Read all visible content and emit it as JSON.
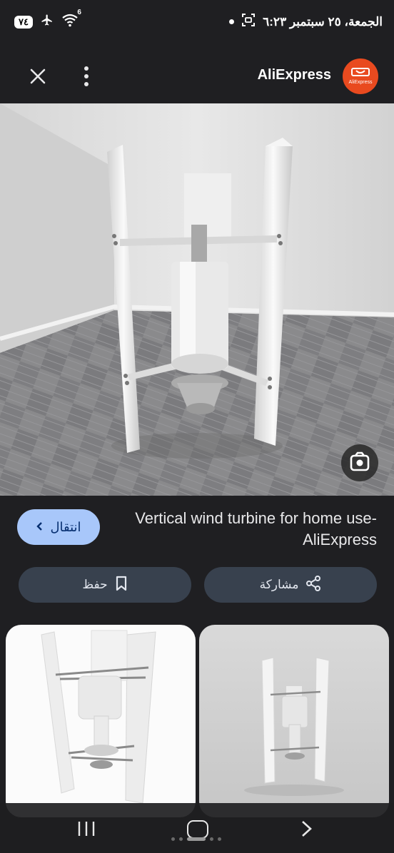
{
  "status_bar": {
    "battery": "٧٤",
    "wifi_badge": "6",
    "datetime": "الجمعة، ٢٥ سبتمبر ٦:٢٣"
  },
  "top_bar": {
    "site_name": "AliExpress",
    "logo_text": "AliExpress"
  },
  "result": {
    "title": "Vertical wind turbine for home use- AliExpress",
    "visit_label": "انتقال",
    "save_label": "حفظ",
    "share_label": "مشاركة"
  },
  "colors": {
    "accent_button": "#a8c7fa",
    "action_button": "#38414e",
    "logo_bg": "#e94a1f"
  }
}
